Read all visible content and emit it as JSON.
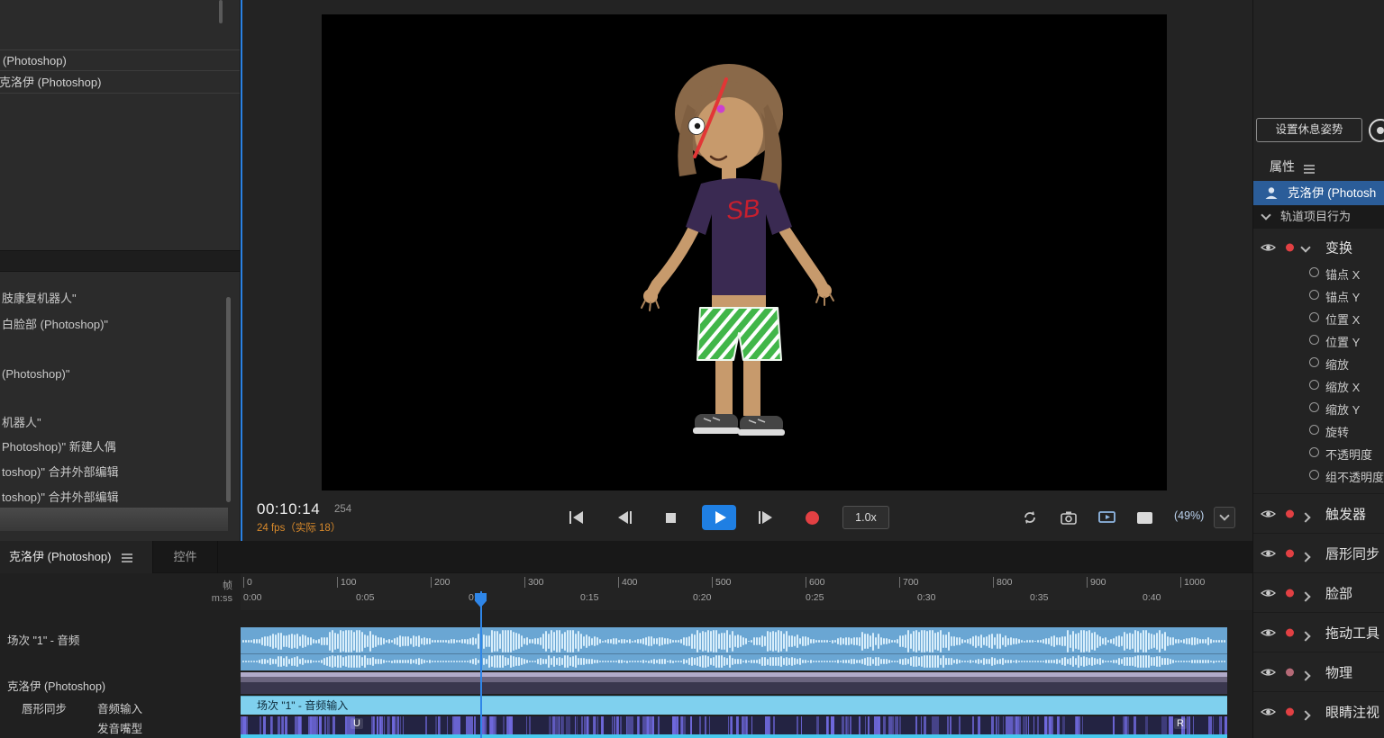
{
  "colors": {
    "selection_blue": "#2b5d99",
    "record_red": "#e24043",
    "play_blue": "#1f7fe3",
    "fps_orange": "#d98a2b",
    "audio_track_blue": "#6aa6d3",
    "lipsync_cyan": "#7fd0ee",
    "viseme_purple": "#6f69dd",
    "playhead_blue": "#2f86e8"
  },
  "left_panel": {
    "top_items": [
      "(Photoshop)",
      "克洛伊 (Photoshop)"
    ],
    "history_items": [
      "肢康复机器人\"",
      "白脸部 (Photoshop)\"",
      "(Photoshop)\"",
      "机器人\"",
      "Photoshop)\" 新建人偶",
      "toshop)\" 合并外部编辑",
      "toshop)\" 合并外部编辑"
    ]
  },
  "stage": {
    "shirt_text": "SB"
  },
  "playback": {
    "timecode": "00:10:14",
    "frame_number": "254",
    "fps_info": "24 fps（实际 18）",
    "speed": "1.0x",
    "zoom_level": "(49%)"
  },
  "timeline": {
    "tabs": [
      "克洛伊 (Photoshop)",
      "控件"
    ],
    "ruler": {
      "frame_unit": "帧",
      "time_unit": "m:ss",
      "frame_ticks": [
        "0",
        "100",
        "200",
        "300",
        "400",
        "500",
        "600",
        "700",
        "800",
        "900",
        "1000"
      ],
      "time_ticks": [
        "0:00",
        "0:05",
        "0:10",
        "0:15",
        "0:20",
        "0:25",
        "0:30",
        "0:35",
        "0:40"
      ]
    },
    "tracks": {
      "audio_header": "场次 \"1\" - 音频",
      "puppet_header": "克洛伊 (Photoshop)",
      "lipsync_header": "唇形同步",
      "audio_input_header": "音频输入",
      "viseme_header": "发音嘴型",
      "audio_input_bar_label": "场次 \"1\" - 音频输入",
      "viseme_marks": [
        "U",
        "R"
      ]
    }
  },
  "properties": {
    "rest_pose_button": "设置休息姿势",
    "panel_title": "属性",
    "selected_puppet": "克洛伊 (Photosh",
    "section_title": "轨道项目行为",
    "transform": {
      "label": "变换",
      "channels": [
        "锚点 X",
        "锚点 Y",
        "位置 X",
        "位置 Y",
        "缩放",
        "缩放 X",
        "缩放 Y",
        "旋转",
        "不透明度",
        "组不透明度"
      ]
    },
    "behaviors": [
      "触发器",
      "唇形同步",
      "脸部",
      "拖动工具",
      "物理",
      "眼睛注视"
    ]
  }
}
